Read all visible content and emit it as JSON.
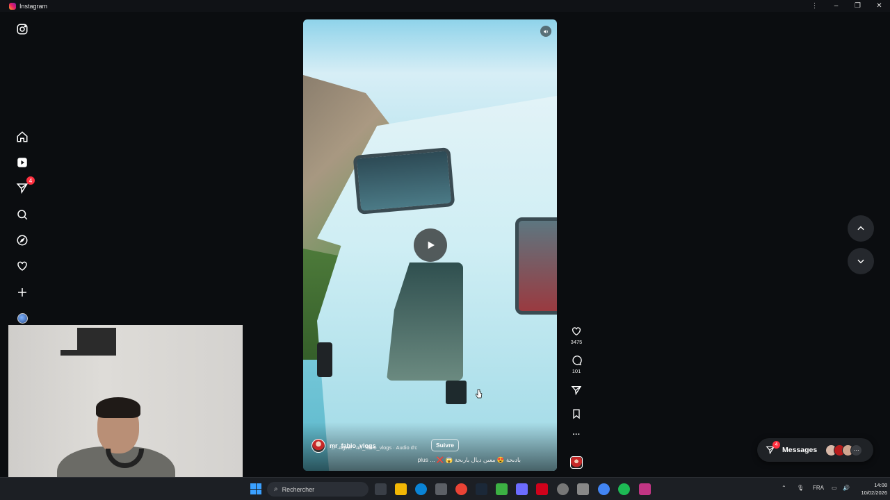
{
  "window": {
    "title": "Instagram",
    "controls": {
      "menu": "⋮",
      "minimize": "–",
      "restore": "❐",
      "close": "✕"
    }
  },
  "sidebar": {
    "logo_icon": "instagram-logo-icon",
    "items": [
      {
        "name": "home",
        "icon": "home-icon"
      },
      {
        "name": "reels",
        "icon": "reels-icon"
      },
      {
        "name": "messages",
        "icon": "send-icon",
        "badge": "4"
      },
      {
        "name": "search",
        "icon": "search-icon"
      },
      {
        "name": "explore",
        "icon": "compass-icon"
      },
      {
        "name": "notifications",
        "icon": "heart-icon"
      },
      {
        "name": "create",
        "icon": "plus-icon"
      },
      {
        "name": "profile",
        "icon": "avatar"
      }
    ]
  },
  "reel": {
    "username": "mr_fabio_vlogs",
    "audio_track": "ngine",
    "audio_source": "mr_fabio_vlogs · Audio d'c",
    "follow_label": "Suivre",
    "caption": "plus ... ❌ 😱 بادىحة 😍 معىن ديال بارىحة",
    "mute_icon": "speaker-icon",
    "play_icon": "play-icon"
  },
  "actions": {
    "like_count": "3475",
    "comment_count": "101",
    "share_icon": "send-icon",
    "save_icon": "bookmark-icon",
    "more_label": "···"
  },
  "messages_pill": {
    "label": "Messages",
    "badge": "4",
    "more": "···",
    "face_colors": [
      "#d8b8a8",
      "#b71c1c",
      "#cfa690"
    ]
  },
  "taskbar": {
    "search_placeholder": "Rechercher",
    "language": "FRA",
    "time": "14:08",
    "date": "10/02/2026",
    "app_colors": [
      "#3a3f47",
      "#f2b705",
      "#0a84d6",
      "#5c6066",
      "#ea4335",
      "#1b2838",
      "#3cb043",
      "#6c6cff",
      "#d0021b",
      "#777",
      "#888",
      "#4285f4",
      "#1db954",
      "#c13584"
    ]
  }
}
